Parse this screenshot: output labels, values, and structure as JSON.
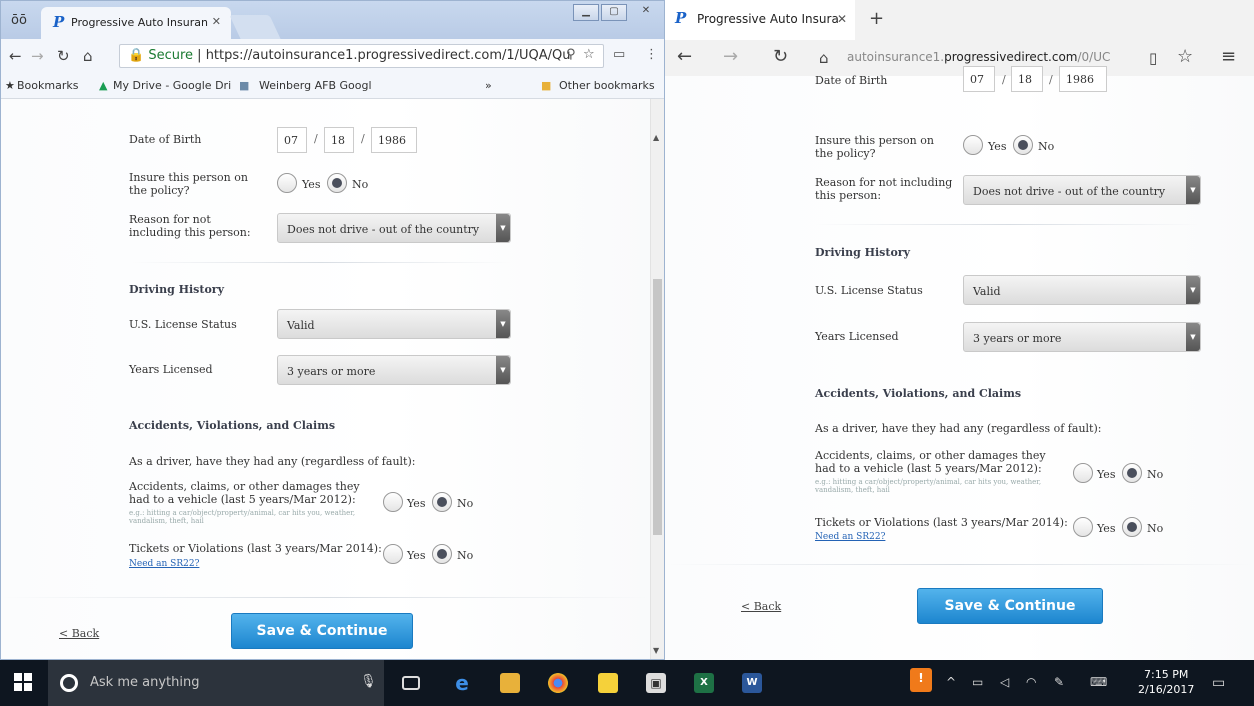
{
  "left_window": {
    "tab_title": "Progressive Auto Insuran",
    "url_secure": "Secure",
    "url": "https://autoinsurance1.progressivedirect.com/1/UQA/Qu",
    "bookmarks": [
      "Bookmarks",
      "My Drive - Google Dri",
      "Weinberg AFB Googl"
    ],
    "bookmarks_more": "»",
    "other_bookmarks": "Other bookmarks"
  },
  "right_window": {
    "tab_title": "Progressive Auto Insura",
    "url_domain_start": "autoinsurance1.",
    "url_domain": "progressivedirect.com",
    "url_path": "/0/UC"
  },
  "form": {
    "dob_label": "Date of Birth",
    "dob_month": "07",
    "dob_day": "18",
    "dob_year": "1986",
    "dob_sep": "/",
    "insure_label": "Insure this person on the policy?",
    "yes": "Yes",
    "no": "No",
    "reason_label": "Reason for not including this person:",
    "reason_value": "Does not drive - out of the country",
    "driving_history": "Driving History",
    "license_label": "U.S. License Status",
    "license_value": "Valid",
    "years_label": "Years Licensed",
    "years_value": "3 years or more",
    "avc_heading": "Accidents, Violations, and Claims",
    "avc_intro": "As a driver, have they had any (regardless of fault):",
    "accidents_label": "Accidents, claims, or other damages they had to a vehicle (last 5 years/Mar 2012):",
    "accidents_note": "e.g.: hitting a car/object/property/animal, car hits you, weather, vandalism, theft, hail",
    "tickets_label": "Tickets or Violations (last 3 years/Mar 2014):",
    "sr22_link": "Need an SR22?",
    "back": "< Back",
    "save": "Save & Continue"
  },
  "taskbar": {
    "search_placeholder": "Ask me anything",
    "time": "7:15 PM",
    "date": "2/16/2017"
  }
}
